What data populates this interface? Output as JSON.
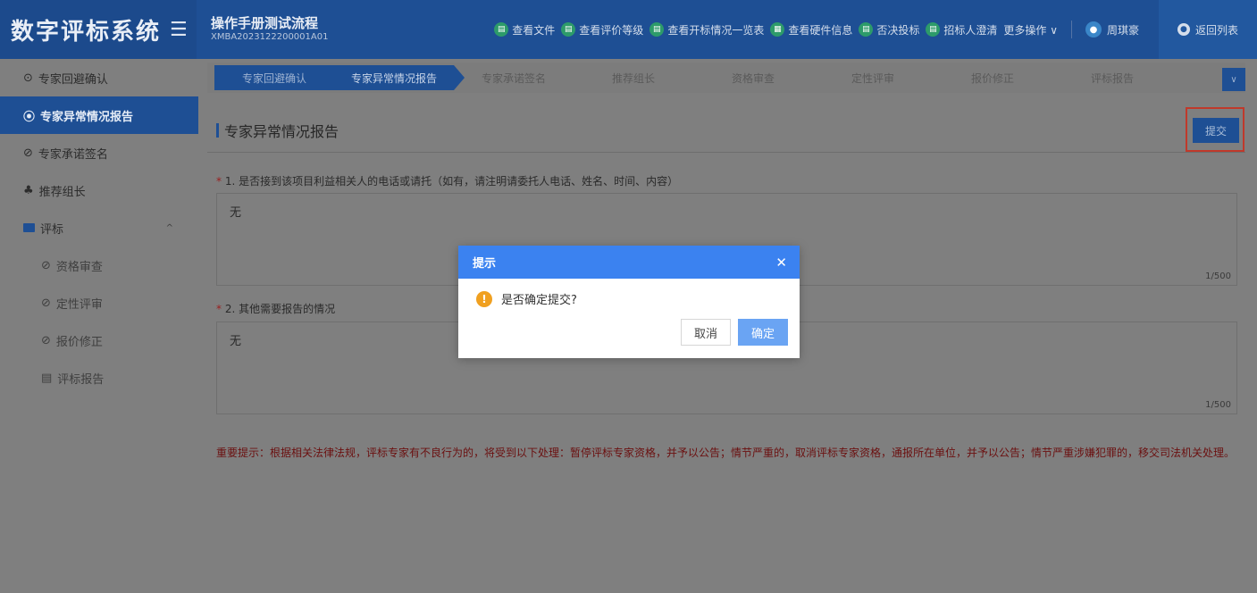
{
  "app": {
    "title": "数字评标系统",
    "menu_icon": "menu-icon"
  },
  "project": {
    "name": "操作手册测试流程",
    "code": "XMBA2023122200001A01"
  },
  "header_actions": [
    {
      "label": "查看文件",
      "icon": "file-icon"
    },
    {
      "label": "查看评价等级",
      "icon": "rating-icon"
    },
    {
      "label": "查看开标情况一览表",
      "icon": "table-icon"
    },
    {
      "label": "查看硬件信息",
      "icon": "hardware-icon"
    },
    {
      "label": "否决投标",
      "icon": "reject-icon"
    },
    {
      "label": "招标人澄清",
      "icon": "clarify-icon"
    },
    {
      "label": "更多操作 ∨",
      "icon": ""
    }
  ],
  "user": {
    "name": "周琪豪"
  },
  "back_label": "返回列表",
  "sidebar": {
    "items": [
      {
        "label": "专家回避确认",
        "icon": "check-circle-icon"
      },
      {
        "label": "专家异常情况报告",
        "icon": "radio-dot-icon"
      },
      {
        "label": "专家承诺签名",
        "icon": "disabled-icon"
      },
      {
        "label": "推荐组长",
        "icon": "people-icon"
      },
      {
        "label": "评标",
        "icon": "folder-icon"
      },
      {
        "label": "资格审查",
        "icon": "disabled-icon"
      },
      {
        "label": "定性评审",
        "icon": "disabled-icon"
      },
      {
        "label": "报价修正",
        "icon": "disabled-icon"
      },
      {
        "label": "评标报告",
        "icon": "doc-icon"
      }
    ]
  },
  "steps": [
    "专家回避确认",
    "专家异常情况报告",
    "专家承诺签名",
    "推荐组长",
    "资格审查",
    "定性评审",
    "报价修正",
    "评标报告"
  ],
  "panel": {
    "title": "专家异常情况报告",
    "submit_label": "提交",
    "q1": "1. 是否接到该项目利益相关人的电话或请托（如有，请注明请委托人电话、姓名、时间、内容）",
    "a1": "无",
    "a1_count": "1/500",
    "q2": "2. 其他需要报告的情况",
    "a2": "无",
    "a2_count": "1/500",
    "notice": "重要提示：根据相关法律法规，评标专家有不良行为的，将受到以下处理：暂停评标专家资格，并予以公告；情节严重的，取消评标专家资格，通报所在单位，并予以公告；情节严重涉嫌犯罪的，移交司法机关处理。"
  },
  "modal": {
    "title": "提示",
    "message": "是否确定提交?",
    "cancel": "取消",
    "ok": "确定"
  }
}
